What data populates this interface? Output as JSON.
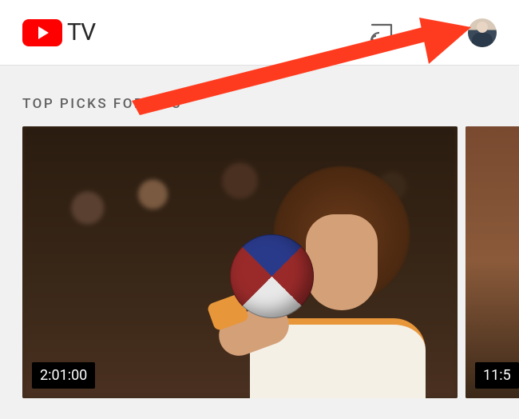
{
  "header": {
    "brand_text": "TV",
    "icons": {
      "cast": "cast-icon",
      "search": "search-icon",
      "avatar": "profile-avatar"
    }
  },
  "section": {
    "title": "TOP PICKS FOR YOU"
  },
  "cards": [
    {
      "duration": "2:01:00"
    },
    {
      "duration": "11:5"
    }
  ],
  "colors": {
    "brand_red": "#ff0000",
    "arrow": "#ff3b1f"
  }
}
